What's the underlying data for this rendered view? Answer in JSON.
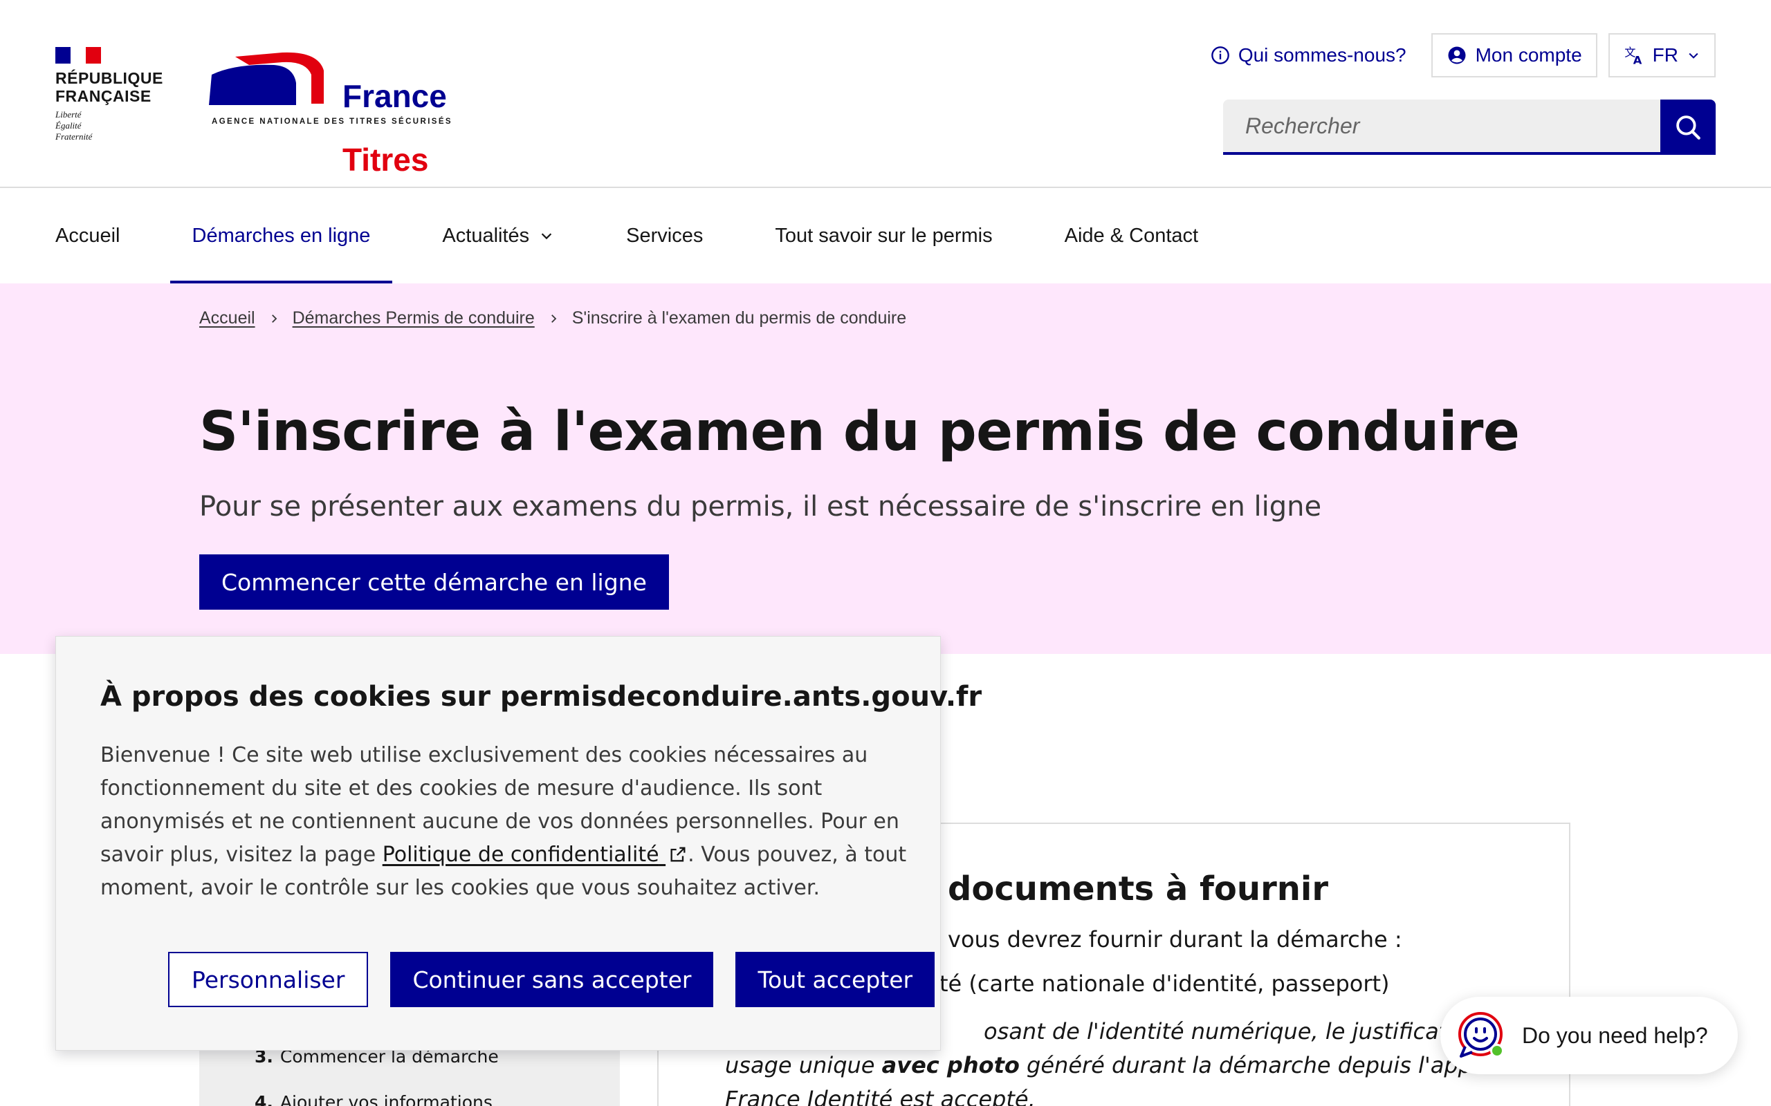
{
  "header": {
    "rf_name": "RÉPUBLIQUE\nFRANÇAISE",
    "rf_motto": "Liberté\nÉgalité\nFraternité",
    "brand_line1": "France",
    "brand_line2": "Titres",
    "brand_tagline": "AGENCE NATIONALE DES TITRES SÉCURISÉS",
    "tools": {
      "about_label": "Qui sommes-nous?",
      "account_label": "Mon compte",
      "lang_label": "FR"
    },
    "search": {
      "placeholder": "Rechercher"
    }
  },
  "nav": {
    "items": [
      {
        "label": "Accueil"
      },
      {
        "label": "Démarches en ligne"
      },
      {
        "label": "Actualités"
      },
      {
        "label": "Services"
      },
      {
        "label": "Tout savoir sur le permis"
      },
      {
        "label": "Aide & Contact"
      }
    ]
  },
  "breadcrumb": {
    "home": "Accueil",
    "section": "Démarches Permis de conduire",
    "current": "S'inscrire à l'examen du permis de conduire"
  },
  "hero": {
    "title": "S'inscrire à l'examen du permis de conduire",
    "subtitle": "Pour se présenter aux examens du permis, il est nécessaire de s'inscrire en ligne",
    "cta": "Commencer cette démarche en ligne"
  },
  "steps": {
    "step3_num": "3.",
    "step3_label": "Commencer la démarche",
    "step4_num": "4.",
    "step4_label": "Ajouter vos informations"
  },
  "documents": {
    "title": "documents à fournir",
    "intro": "vous devrez fournir durant la démarche :",
    "item1": "té (carte nationale d'identité, passeport)",
    "note_l1": "osant de l'identité numérique, le justificatif d'ide",
    "note_l2_pre": "usage unique ",
    "note_l2_bold": "avec photo",
    "note_l2_post": " généré durant la démarche depuis l'applicati",
    "note_l3": "France Identité est accepté."
  },
  "cookie": {
    "title": "À propos des cookies sur permisdeconduire.ants.gouv.fr",
    "text_part1": "Bienvenue ! Ce site web utilise exclusivement des cookies nécessaires au fonctionnement du site et des cookies de mesure d'audience. Ils sont anonymisés et ne contiennent aucune de vos données personnelles. Pour en savoir plus, visitez la page ",
    "link": "Politique de confidentialité",
    "text_part2": ". Vous pouvez, à tout moment, avoir le contrôle sur les cookies que vous souhaitez activer.",
    "btn_customize": "Personnaliser",
    "btn_refuse": "Continuer sans accepter",
    "btn_accept": "Tout accepter"
  },
  "help": {
    "label": "Do you need help?"
  },
  "colors": {
    "primary": "#000091",
    "marianne_red": "#e1000f",
    "hero_bg": "#fee7fc",
    "status_online": "#53c22b"
  },
  "icons": [
    "info-icon",
    "account-icon",
    "translate-icon",
    "chevron-down-icon",
    "search-icon",
    "chevron-right-icon",
    "external-link-icon",
    "chat-bot-icon"
  ]
}
